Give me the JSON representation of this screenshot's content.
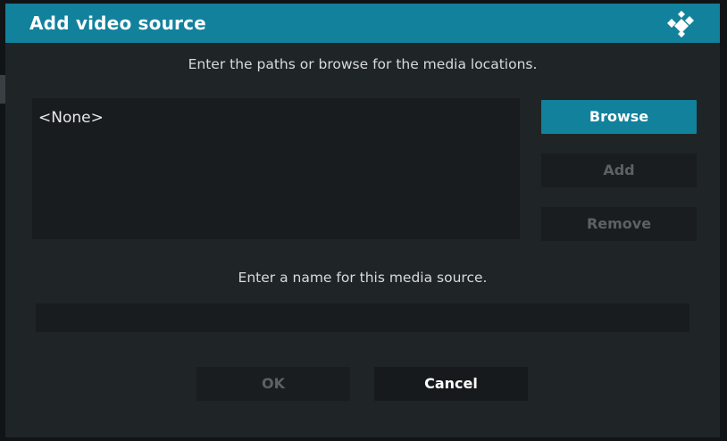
{
  "dialog": {
    "title": "Add video source",
    "logo_icon": "kodi-logo-icon",
    "paths_instruction": "Enter the paths or browse for the media locations.",
    "paths": [
      "<None>"
    ],
    "buttons": {
      "browse": "Browse",
      "add": "Add",
      "remove": "Remove",
      "ok": "OK",
      "cancel": "Cancel"
    },
    "name_instruction": "Enter a name for this media source.",
    "name_value": ""
  },
  "colors": {
    "accent": "#12819c",
    "dialog_bg": "#1f2426",
    "field_bg": "#181c1e",
    "disabled_text": "#5b6164"
  }
}
